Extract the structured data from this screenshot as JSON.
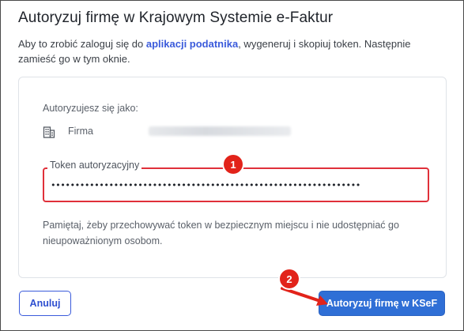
{
  "dialog": {
    "title": "Autoryzuj firmę w Krajowym Systemie e-Faktur",
    "intro_before": "Aby to zrobić zaloguj się do ",
    "intro_link": "aplikacji podatnika",
    "intro_after": ", wygeneruj i skopiuj token. Następnie zamieść go w tym oknie."
  },
  "panel": {
    "auth_as_label": "Autoryzujesz się jako:",
    "firm_label": "Firma",
    "firm_icon": "building-icon",
    "token_label": "Token autoryzacyjny",
    "token_value": "••••••••••••••••••••••••••••••••••••••••••••••••••••••••••••••••",
    "hint": "Pamiętaj, żeby przechowywać token w bezpiecznym miejscu i nie udostępniać go nieupoważnionym osobom."
  },
  "annotations": {
    "badge_1": "1",
    "badge_2": "2",
    "color": "#e2231a"
  },
  "buttons": {
    "cancel": "Anuluj",
    "submit": "Autoryzuj firmę w KSeF"
  }
}
